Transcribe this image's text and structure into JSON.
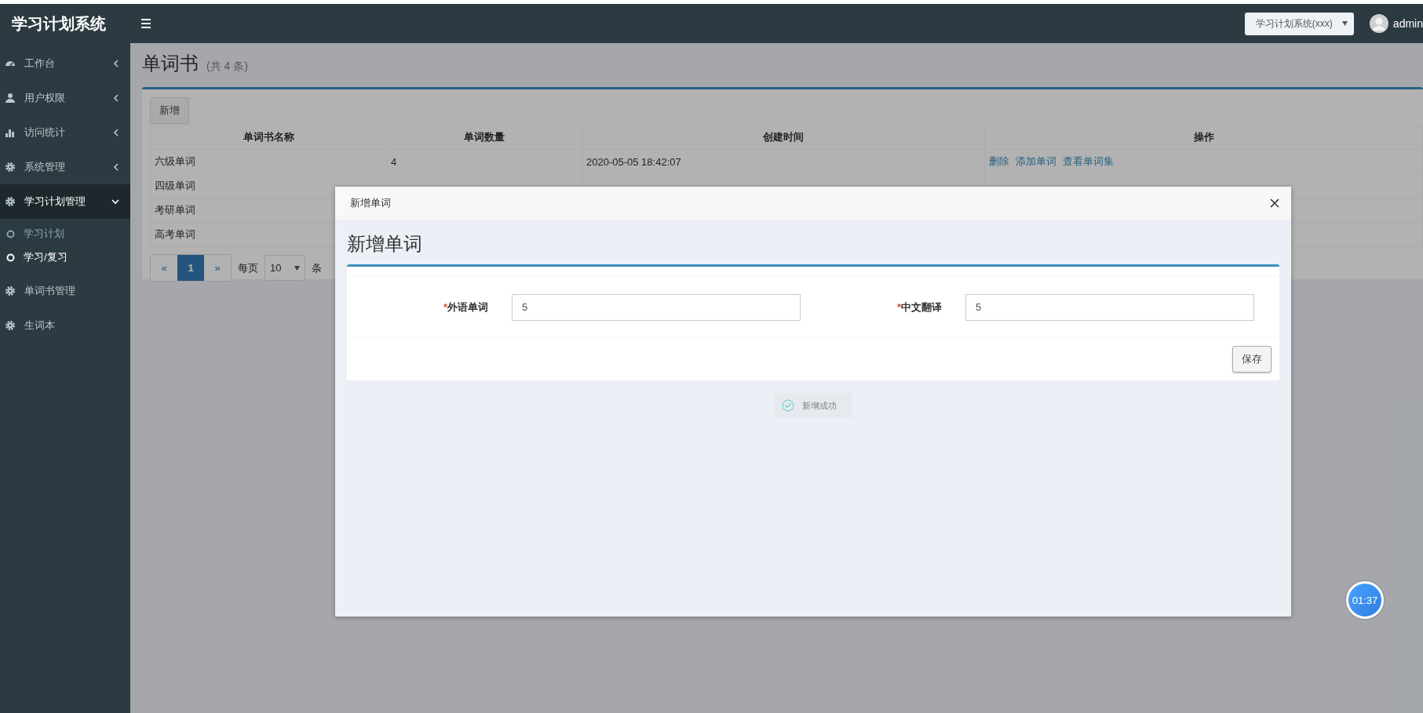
{
  "header": {
    "logo": "学习计划系统",
    "system_select": {
      "value": "学习计划系统(xxx)"
    },
    "user": "admin"
  },
  "sidebar": {
    "items": [
      {
        "label": "工作台",
        "expanded": false
      },
      {
        "label": "用户权限",
        "expanded": false
      },
      {
        "label": "访问统计",
        "expanded": false
      },
      {
        "label": "系统管理",
        "expanded": false
      },
      {
        "label": "学习计划管理",
        "expanded": true,
        "children": [
          {
            "label": "学习计划",
            "selected": false
          },
          {
            "label": "学习/复习",
            "selected": true
          }
        ]
      },
      {
        "label": "单词书管理"
      },
      {
        "label": "生词本"
      }
    ]
  },
  "page": {
    "title": "单词书",
    "count": "(共 4 条)",
    "add_button": "新增",
    "table": {
      "columns": [
        "单词书名称",
        "单词数量",
        "创建时间",
        "操作"
      ],
      "rows": [
        {
          "cells": [
            "六级单词",
            "4",
            "2020-05-05 18:42:07"
          ],
          "actions": [
            "删除",
            "添加单词",
            "查看单词集"
          ]
        },
        {
          "cells": [
            "四级单词"
          ]
        },
        {
          "cells": [
            "考研单词"
          ]
        },
        {
          "cells": [
            "高考单词"
          ]
        }
      ]
    },
    "pagination": {
      "prev": "«",
      "pages": [
        {
          "label": "1",
          "selected": true
        }
      ],
      "next": "»",
      "per_page_label": "每页",
      "per_page": "10",
      "unit": "条"
    }
  },
  "modal": {
    "title": "新增单词",
    "heading": "新增单词",
    "fields": [
      {
        "required_mark": "*",
        "label": "外语单词",
        "value": "5"
      },
      {
        "required_mark": "*",
        "label": "中文翻译",
        "value": "5"
      }
    ],
    "save_button": "保存"
  },
  "toast": {
    "text": "新增成功"
  },
  "timer": {
    "text": "01:37"
  }
}
